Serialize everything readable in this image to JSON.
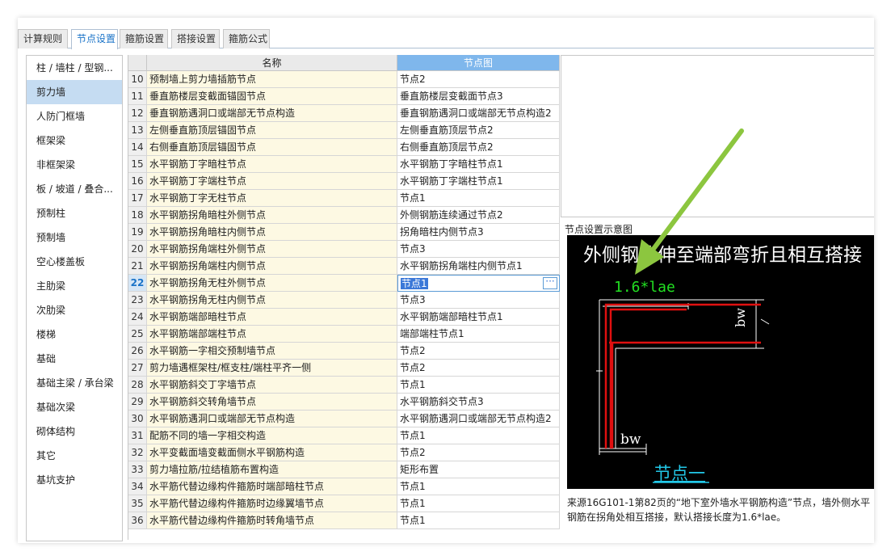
{
  "tabs": [
    "计算规则",
    "节点设置",
    "箍筋设置",
    "搭接设置",
    "箍筋公式"
  ],
  "active_tab": 1,
  "sidebar": {
    "items": [
      "柱 / 墙柱 / 型钢...",
      "剪力墙",
      "人防门框墙",
      "框架梁",
      "非框架梁",
      "板 / 坡道 / 叠合...",
      "预制柱",
      "预制墙",
      "空心楼盖板",
      "主肋梁",
      "次肋梁",
      "楼梯",
      "基础",
      "基础主梁 / 承台梁",
      "基础次梁",
      "砌体结构",
      "其它",
      "基坑支护"
    ],
    "active": 1
  },
  "table": {
    "headers": {
      "name": "名称",
      "node": "节点图"
    },
    "rows": [
      {
        "num": "10",
        "name": "预制墙上剪力墙插筋节点",
        "node": "节点2"
      },
      {
        "num": "11",
        "name": "垂直筋楼层变截面锚固节点",
        "node": "垂直筋楼层变截面节点3"
      },
      {
        "num": "12",
        "name": "垂直钢筋遇洞口或端部无节点构造",
        "node": "垂直钢筋遇洞口或端部无节点构造2"
      },
      {
        "num": "13",
        "name": "左侧垂直筋顶层锚固节点",
        "node": "左侧垂直筋顶层节点2"
      },
      {
        "num": "14",
        "name": "右侧垂直筋顶层锚固节点",
        "node": "右侧垂直筋顶层节点2"
      },
      {
        "num": "15",
        "name": "水平钢筋丁字暗柱节点",
        "node": "水平钢筋丁字暗柱节点1"
      },
      {
        "num": "16",
        "name": "水平钢筋丁字端柱节点",
        "node": "水平钢筋丁字端柱节点1"
      },
      {
        "num": "17",
        "name": "水平钢筋丁字无柱节点",
        "node": "节点1"
      },
      {
        "num": "18",
        "name": "水平钢筋拐角暗柱外侧节点",
        "node": "外侧钢筋连续通过节点2"
      },
      {
        "num": "19",
        "name": "水平钢筋拐角暗柱内侧节点",
        "node": "拐角暗柱内侧节点3"
      },
      {
        "num": "20",
        "name": "水平钢筋拐角端柱外侧节点",
        "node": "节点3"
      },
      {
        "num": "21",
        "name": "水平钢筋拐角端柱内侧节点",
        "node": "水平钢筋拐角端柱内侧节点1"
      },
      {
        "num": "22",
        "name": "水平钢筋拐角无柱外侧节点",
        "node": "节点1"
      },
      {
        "num": "23",
        "name": "水平钢筋拐角无柱内侧节点",
        "node": "节点3"
      },
      {
        "num": "24",
        "name": "水平钢筋端部暗柱节点",
        "node": "水平钢筋端部暗柱节点1"
      },
      {
        "num": "25",
        "name": "水平钢筋端部端柱节点",
        "node": "端部端柱节点1"
      },
      {
        "num": "26",
        "name": "水平钢筋一字相交预制墙节点",
        "node": "节点2"
      },
      {
        "num": "27",
        "name": "剪力墙遇框架柱/框支柱/端柱平齐一侧",
        "node": "节点2"
      },
      {
        "num": "28",
        "name": "水平钢筋斜交丁字墙节点",
        "node": "节点1"
      },
      {
        "num": "29",
        "name": "水平钢筋斜交转角墙节点",
        "node": "水平钢筋斜交节点3"
      },
      {
        "num": "30",
        "name": "水平钢筋遇洞口或端部无节点构造",
        "node": "水平钢筋遇洞口或端部无节点构造2"
      },
      {
        "num": "31",
        "name": "配筋不同的墙一字相交构造",
        "node": "节点1"
      },
      {
        "num": "32",
        "name": "水平变截面墙变截面侧水平钢筋构造",
        "node": "节点2"
      },
      {
        "num": "33",
        "name": "剪力墙拉筋/拉结植筋布置构造",
        "node": "矩形布置"
      },
      {
        "num": "34",
        "name": "水平筋代替边缘构件箍筋时端部暗柱节点",
        "node": "节点1"
      },
      {
        "num": "35",
        "name": "水平筋代替边缘构件箍筋时边缘翼墙节点",
        "node": "节点1"
      },
      {
        "num": "36",
        "name": "水平筋代替边缘构件箍筋时转角墙节点",
        "node": "节点1"
      }
    ],
    "active_row": 12,
    "more_button_label": "···"
  },
  "preview": {
    "title": "节点设置示意图",
    "heading": "外侧钢筋伸至端部弯折且相互搭接",
    "lap_label": "1.6*lae",
    "bw_label": "bw",
    "bw_side_label": "bw",
    "caption": "节点一",
    "desc_line1": "来源16G101-1第82页的“地下室外墙水平钢筋构造”节点，墙外侧水平",
    "desc_line2": "钢筋在拐角处相互搭接，默认搭接长度为1.6*lae。"
  },
  "colors": {
    "accent": "#1a73c8",
    "header_blue": "#7fb7ec",
    "sidebar_active": "#c5dcf2",
    "name_cell": "#fdf9e3",
    "rebar_red": "#e01010",
    "label_green": "#22e022",
    "caption_cyan": "#22c8e8",
    "arrow_green": "#8cc63f"
  }
}
